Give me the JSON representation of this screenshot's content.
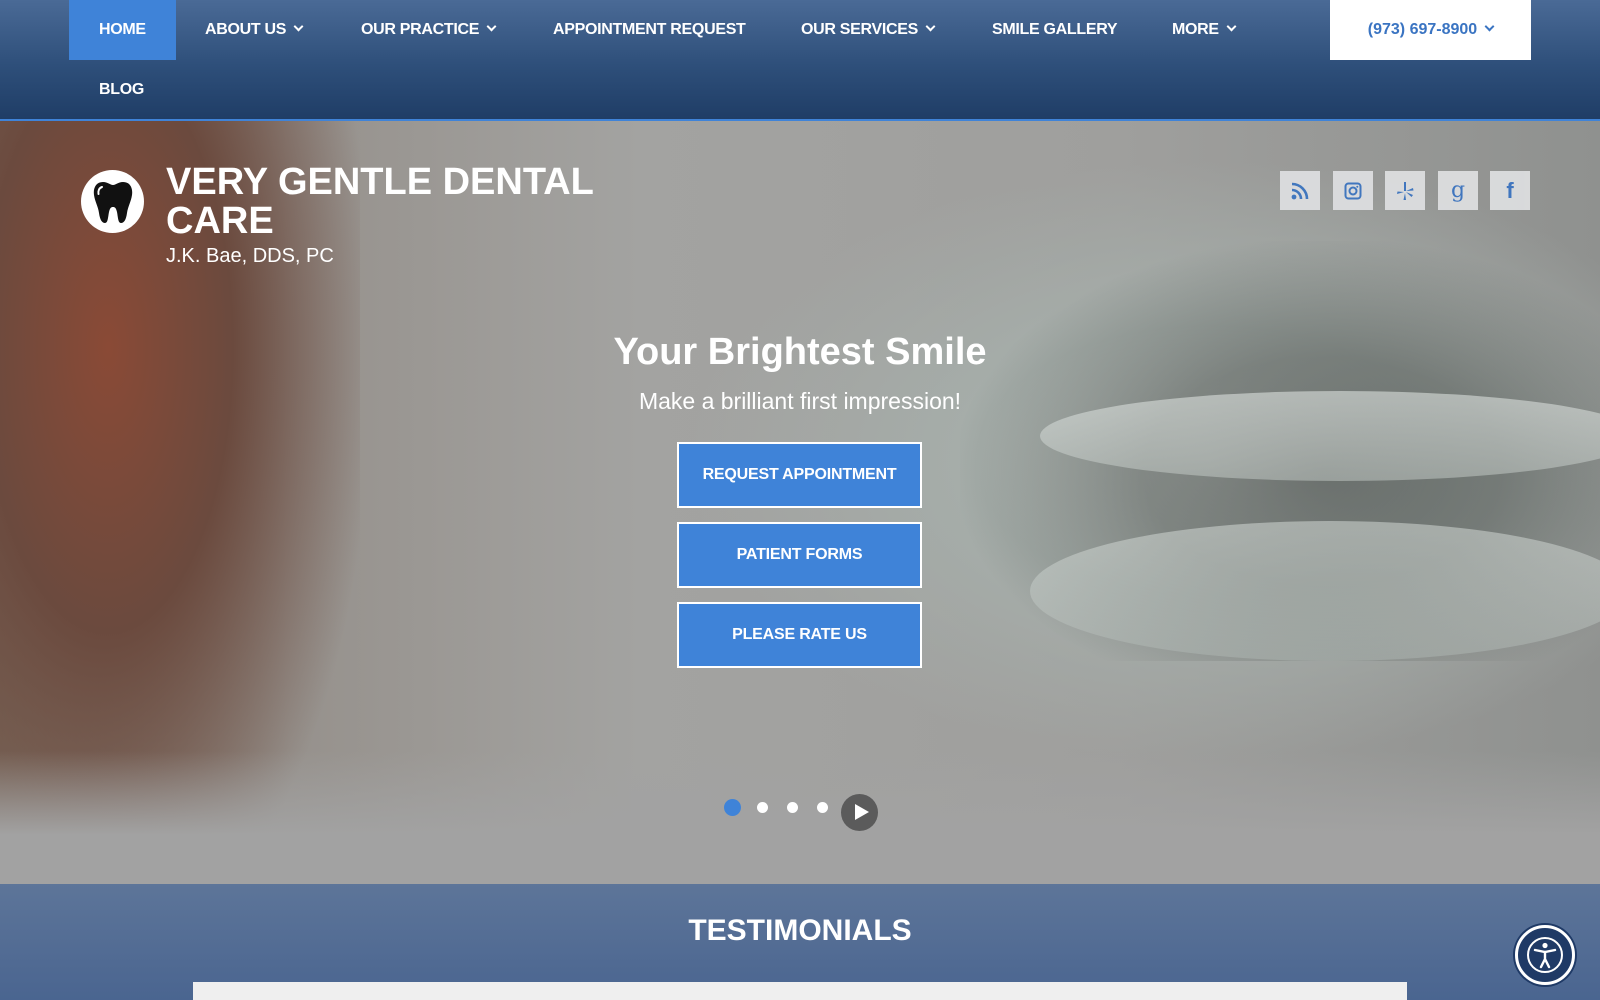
{
  "nav": {
    "items": [
      {
        "label": "HOME",
        "has_dropdown": false,
        "active": true
      },
      {
        "label": "ABOUT US",
        "has_dropdown": true
      },
      {
        "label": "OUR PRACTICE",
        "has_dropdown": true
      },
      {
        "label": "APPOINTMENT REQUEST",
        "has_dropdown": false
      },
      {
        "label": "OUR SERVICES",
        "has_dropdown": true
      },
      {
        "label": "SMILE GALLERY",
        "has_dropdown": false
      },
      {
        "label": "MORE",
        "has_dropdown": true
      },
      {
        "label": "BLOG",
        "has_dropdown": false
      }
    ],
    "phone": "(973) 697-8900"
  },
  "brand": {
    "name": "VERY GENTLE DENTAL CARE",
    "subtitle": "J.K. Bae, DDS, PC",
    "logo_icon": "tooth-icon"
  },
  "social": [
    {
      "name": "rss-icon",
      "glyph": "rss"
    },
    {
      "name": "instagram-icon",
      "glyph": "instagram"
    },
    {
      "name": "yelp-icon",
      "glyph": "yelp"
    },
    {
      "name": "google-icon",
      "glyph": "g"
    },
    {
      "name": "facebook-icon",
      "glyph": "f"
    }
  ],
  "hero": {
    "title": "Your Brightest Smile",
    "subtitle": "Make a brilliant first impression!",
    "buttons": [
      "REQUEST APPOINTMENT",
      "PATIENT FORMS",
      "PLEASE RATE US"
    ],
    "slides_total": 4,
    "slide_active": 1
  },
  "testimonials": {
    "title": "TESTIMONIALS"
  },
  "colors": {
    "accent": "#3f83d8",
    "nav_dark": "#1f3d66",
    "phone_text": "#3a74c2"
  }
}
